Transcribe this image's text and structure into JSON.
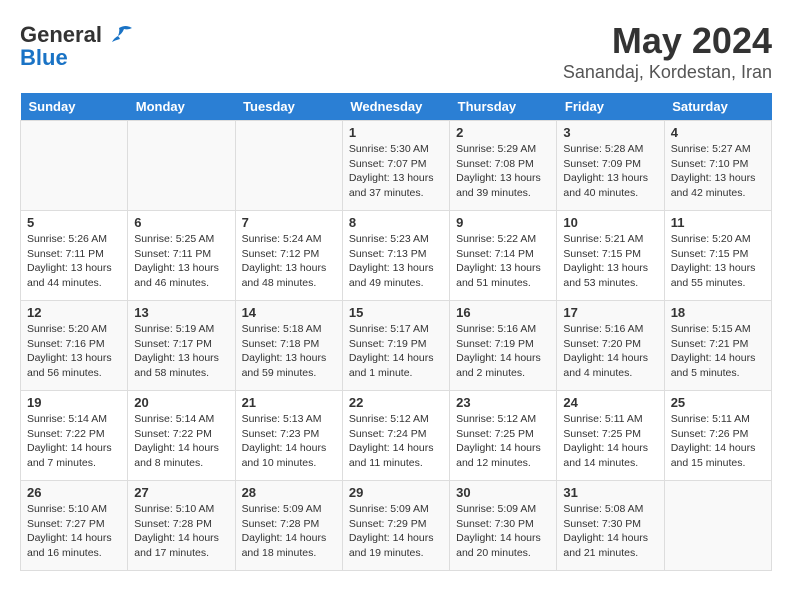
{
  "header": {
    "logo_general": "General",
    "logo_blue": "Blue",
    "month": "May 2024",
    "location": "Sanandaj, Kordestan, Iran"
  },
  "weekdays": [
    "Sunday",
    "Monday",
    "Tuesday",
    "Wednesday",
    "Thursday",
    "Friday",
    "Saturday"
  ],
  "weeks": [
    [
      {
        "day": "",
        "info": ""
      },
      {
        "day": "",
        "info": ""
      },
      {
        "day": "",
        "info": ""
      },
      {
        "day": "1",
        "info": "Sunrise: 5:30 AM\nSunset: 7:07 PM\nDaylight: 13 hours\nand 37 minutes."
      },
      {
        "day": "2",
        "info": "Sunrise: 5:29 AM\nSunset: 7:08 PM\nDaylight: 13 hours\nand 39 minutes."
      },
      {
        "day": "3",
        "info": "Sunrise: 5:28 AM\nSunset: 7:09 PM\nDaylight: 13 hours\nand 40 minutes."
      },
      {
        "day": "4",
        "info": "Sunrise: 5:27 AM\nSunset: 7:10 PM\nDaylight: 13 hours\nand 42 minutes."
      }
    ],
    [
      {
        "day": "5",
        "info": "Sunrise: 5:26 AM\nSunset: 7:11 PM\nDaylight: 13 hours\nand 44 minutes."
      },
      {
        "day": "6",
        "info": "Sunrise: 5:25 AM\nSunset: 7:11 PM\nDaylight: 13 hours\nand 46 minutes."
      },
      {
        "day": "7",
        "info": "Sunrise: 5:24 AM\nSunset: 7:12 PM\nDaylight: 13 hours\nand 48 minutes."
      },
      {
        "day": "8",
        "info": "Sunrise: 5:23 AM\nSunset: 7:13 PM\nDaylight: 13 hours\nand 49 minutes."
      },
      {
        "day": "9",
        "info": "Sunrise: 5:22 AM\nSunset: 7:14 PM\nDaylight: 13 hours\nand 51 minutes."
      },
      {
        "day": "10",
        "info": "Sunrise: 5:21 AM\nSunset: 7:15 PM\nDaylight: 13 hours\nand 53 minutes."
      },
      {
        "day": "11",
        "info": "Sunrise: 5:20 AM\nSunset: 7:15 PM\nDaylight: 13 hours\nand 55 minutes."
      }
    ],
    [
      {
        "day": "12",
        "info": "Sunrise: 5:20 AM\nSunset: 7:16 PM\nDaylight: 13 hours\nand 56 minutes."
      },
      {
        "day": "13",
        "info": "Sunrise: 5:19 AM\nSunset: 7:17 PM\nDaylight: 13 hours\nand 58 minutes."
      },
      {
        "day": "14",
        "info": "Sunrise: 5:18 AM\nSunset: 7:18 PM\nDaylight: 13 hours\nand 59 minutes."
      },
      {
        "day": "15",
        "info": "Sunrise: 5:17 AM\nSunset: 7:19 PM\nDaylight: 14 hours\nand 1 minute."
      },
      {
        "day": "16",
        "info": "Sunrise: 5:16 AM\nSunset: 7:19 PM\nDaylight: 14 hours\nand 2 minutes."
      },
      {
        "day": "17",
        "info": "Sunrise: 5:16 AM\nSunset: 7:20 PM\nDaylight: 14 hours\nand 4 minutes."
      },
      {
        "day": "18",
        "info": "Sunrise: 5:15 AM\nSunset: 7:21 PM\nDaylight: 14 hours\nand 5 minutes."
      }
    ],
    [
      {
        "day": "19",
        "info": "Sunrise: 5:14 AM\nSunset: 7:22 PM\nDaylight: 14 hours\nand 7 minutes."
      },
      {
        "day": "20",
        "info": "Sunrise: 5:14 AM\nSunset: 7:22 PM\nDaylight: 14 hours\nand 8 minutes."
      },
      {
        "day": "21",
        "info": "Sunrise: 5:13 AM\nSunset: 7:23 PM\nDaylight: 14 hours\nand 10 minutes."
      },
      {
        "day": "22",
        "info": "Sunrise: 5:12 AM\nSunset: 7:24 PM\nDaylight: 14 hours\nand 11 minutes."
      },
      {
        "day": "23",
        "info": "Sunrise: 5:12 AM\nSunset: 7:25 PM\nDaylight: 14 hours\nand 12 minutes."
      },
      {
        "day": "24",
        "info": "Sunrise: 5:11 AM\nSunset: 7:25 PM\nDaylight: 14 hours\nand 14 minutes."
      },
      {
        "day": "25",
        "info": "Sunrise: 5:11 AM\nSunset: 7:26 PM\nDaylight: 14 hours\nand 15 minutes."
      }
    ],
    [
      {
        "day": "26",
        "info": "Sunrise: 5:10 AM\nSunset: 7:27 PM\nDaylight: 14 hours\nand 16 minutes."
      },
      {
        "day": "27",
        "info": "Sunrise: 5:10 AM\nSunset: 7:28 PM\nDaylight: 14 hours\nand 17 minutes."
      },
      {
        "day": "28",
        "info": "Sunrise: 5:09 AM\nSunset: 7:28 PM\nDaylight: 14 hours\nand 18 minutes."
      },
      {
        "day": "29",
        "info": "Sunrise: 5:09 AM\nSunset: 7:29 PM\nDaylight: 14 hours\nand 19 minutes."
      },
      {
        "day": "30",
        "info": "Sunrise: 5:09 AM\nSunset: 7:30 PM\nDaylight: 14 hours\nand 20 minutes."
      },
      {
        "day": "31",
        "info": "Sunrise: 5:08 AM\nSunset: 7:30 PM\nDaylight: 14 hours\nand 21 minutes."
      },
      {
        "day": "",
        "info": ""
      }
    ]
  ]
}
